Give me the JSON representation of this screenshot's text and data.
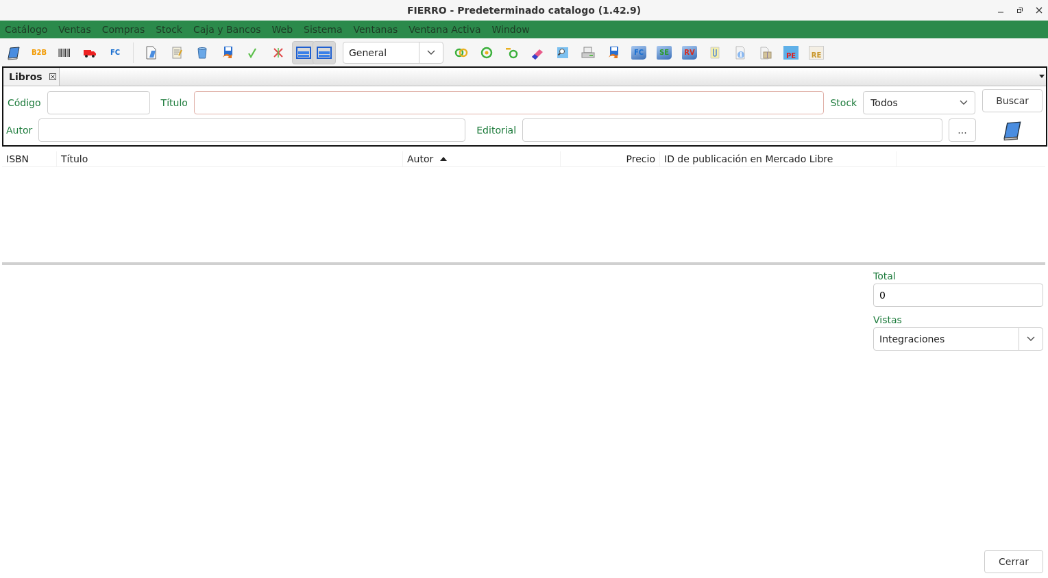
{
  "window": {
    "title": "FIERRO - Predeterminado catalogo (1.42.9)"
  },
  "menu": [
    "Catálogo",
    "Ventas",
    "Compras",
    "Stock",
    "Caja y Bancos",
    "Web",
    "Sistema",
    "Ventanas",
    "Ventana Activa",
    "Window"
  ],
  "toolbar": {
    "left": [
      {
        "kind": "book"
      },
      {
        "kind": "badge",
        "label": "B2B"
      },
      {
        "kind": "barcode"
      },
      {
        "kind": "truck"
      },
      {
        "kind": "badge",
        "label": "FC"
      }
    ],
    "middle": [
      {
        "kind": "document"
      },
      {
        "kind": "notepad"
      },
      {
        "kind": "bin"
      },
      {
        "kind": "floppy"
      },
      {
        "kind": "check"
      },
      {
        "kind": "cross"
      }
    ],
    "toggles": [
      {
        "pressed": true
      },
      {
        "pressed": true
      }
    ],
    "combo": {
      "value": "General"
    },
    "right": [
      {
        "kind": "rings"
      },
      {
        "kind": "target"
      },
      {
        "kind": "ring-dash"
      },
      {
        "kind": "eraser"
      },
      {
        "kind": "magnifier"
      },
      {
        "kind": "printer"
      },
      {
        "kind": "floppy"
      },
      {
        "kind": "book-badge",
        "label": "FC"
      },
      {
        "kind": "book-badge",
        "label": "SE"
      },
      {
        "kind": "book-badge",
        "label": "RV"
      },
      {
        "kind": "clip"
      },
      {
        "kind": "compass"
      },
      {
        "kind": "package"
      },
      {
        "kind": "folder-badge",
        "label": "PE"
      },
      {
        "kind": "page-badge",
        "label": "RE"
      }
    ]
  },
  "tab": {
    "label": "Libros"
  },
  "search": {
    "codigo": {
      "label": "Código",
      "required": false
    },
    "titulo": {
      "label": "Título",
      "required": true
    },
    "stock": {
      "label": "Stock",
      "value": "Todos"
    },
    "buscar": "Buscar",
    "autor": {
      "label": "Autor",
      "required": false
    },
    "editorial": {
      "label": "Editorial",
      "required": false
    },
    "browse": "..."
  },
  "table": {
    "columns": [
      {
        "label": "ISBN",
        "sorted": false
      },
      {
        "label": "Título",
        "sorted": false
      },
      {
        "label": "Autor",
        "sorted": true
      },
      {
        "label": "Precio",
        "sorted": false
      },
      {
        "label": "ID de publicación en Mercado Libre",
        "sorted": false
      }
    ]
  },
  "side": {
    "total_label": "Total",
    "total": "0",
    "vistas_label": "Vistas",
    "vistas": "Integraciones"
  },
  "close_button": "Cerrar"
}
